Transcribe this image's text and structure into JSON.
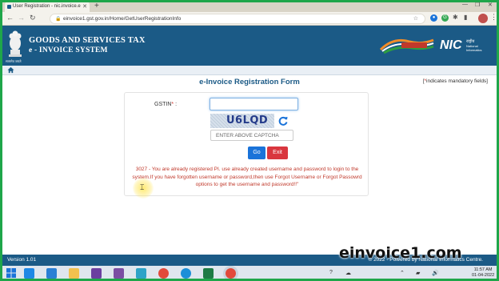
{
  "browser": {
    "tab_title": "User Registration - nic.invoice.e",
    "url": "einvoice1.gst.gov.in/Home/GetUserRegistrationInfo"
  },
  "header": {
    "emblem_caption": "सत्यमेव जयते",
    "title_line1": "GOODS AND SERVICES TAX",
    "title_line2": "e - INVOICE SYSTEM",
    "gst_logo_name": "gst-logo",
    "nic_logo_name": "nic-logo",
    "nic_hindi": "एन आई सी",
    "nic_text": "National Informatics Centre"
  },
  "page": {
    "form_title": "e-Invoice Registration Form",
    "mandatory_prefix": "[",
    "mandatory_star": "*",
    "mandatory_text": "indicates mandatory fields]"
  },
  "form": {
    "gstin_label": "GSTIN",
    "gstin_star": "*",
    "gstin_colon": " :",
    "gstin_value": "",
    "captcha_text": "U6LQD",
    "captcha_placeholder": "ENTER ABOVE CAPTCHA",
    "go_label": "Go",
    "exit_label": "Exit",
    "error_message": "3027 - You are already registered PI. use already created username and password to login to the system.If you have forgotten username or password,then use Forgot Username or Forgot Passowrd options to get the username and password!!\""
  },
  "footer": {
    "version": "Version 1.01",
    "powered": "© 2022 - Powered by National Informatics Centre."
  },
  "watermark": "einvoice1.com",
  "taskbar": {
    "time": "11:57 AM",
    "date": "01-04-2022"
  },
  "colors": {
    "header_blue": "#1b5a86",
    "error_red": "#c0392b",
    "go_blue": "#1a73d9",
    "exit_red": "#d9363e",
    "frame_green": "#1fa64a"
  }
}
